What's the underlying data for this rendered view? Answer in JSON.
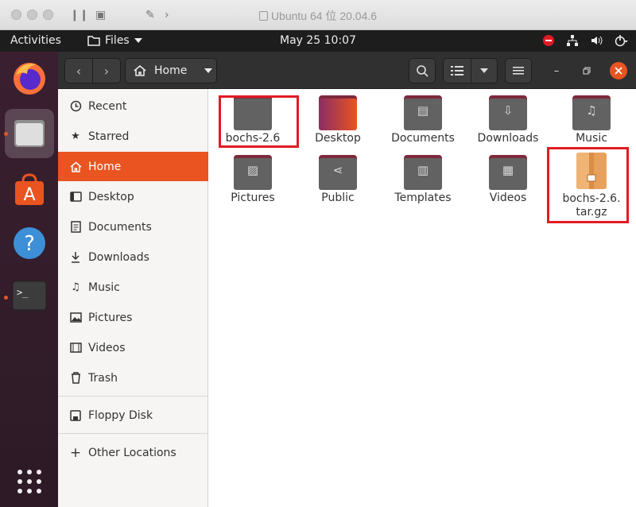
{
  "host": {
    "vm_title": "Ubuntu 64 位 20.04.6"
  },
  "topbar": {
    "activities": "Activities",
    "app_menu": "Files",
    "clock": "May 25  10:07"
  },
  "header": {
    "path_label": "Home"
  },
  "sidebar": {
    "items": [
      {
        "label": "Recent",
        "icon": "clock-icon"
      },
      {
        "label": "Starred",
        "icon": "star-icon"
      },
      {
        "label": "Home",
        "icon": "home-icon"
      },
      {
        "label": "Desktop",
        "icon": "desktop-icon"
      },
      {
        "label": "Documents",
        "icon": "document-icon"
      },
      {
        "label": "Downloads",
        "icon": "download-icon"
      },
      {
        "label": "Music",
        "icon": "music-icon"
      },
      {
        "label": "Pictures",
        "icon": "picture-icon"
      },
      {
        "label": "Videos",
        "icon": "video-icon"
      },
      {
        "label": "Trash",
        "icon": "trash-icon"
      },
      {
        "label": "Floppy Disk",
        "icon": "floppy-icon"
      },
      {
        "label": "Other Locations",
        "icon": "plus-icon"
      }
    ]
  },
  "files": [
    {
      "label": "bochs-2.6",
      "icon": "folder-icon"
    },
    {
      "label": "Desktop",
      "icon": "desktop-folder-icon"
    },
    {
      "label": "Documents",
      "icon": "documents-folder-icon"
    },
    {
      "label": "Downloads",
      "icon": "downloads-folder-icon"
    },
    {
      "label": "Music",
      "icon": "music-folder-icon"
    },
    {
      "label": "Pictures",
      "icon": "pictures-folder-icon"
    },
    {
      "label": "Public",
      "icon": "public-folder-icon"
    },
    {
      "label": "Templates",
      "icon": "templates-folder-icon"
    },
    {
      "label": "Videos",
      "icon": "videos-folder-icon"
    },
    {
      "label": "bochs-2.6.tar.gz",
      "label_line1": "bochs-2.6.",
      "label_line2": "tar.gz",
      "icon": "archive-icon"
    }
  ],
  "colors": {
    "accent": "#e95420",
    "highlight": "#e01b24",
    "folder_tab": "#7d2a3c",
    "folder_body": "#626262"
  }
}
